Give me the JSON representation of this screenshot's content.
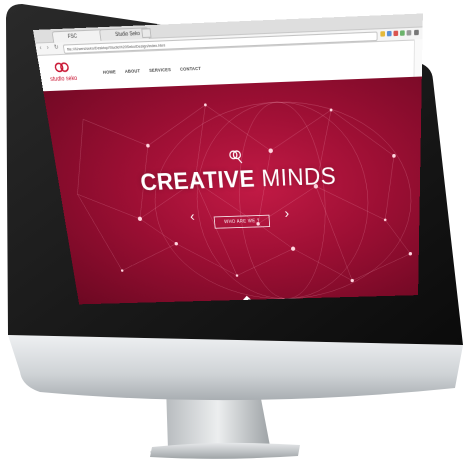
{
  "browser": {
    "tab1_title": "FSC Syndication",
    "tab2_title": "Studio Seko",
    "url": "file:///Users/seko/Desktop/Studio%20Seko/Design/index.html"
  },
  "site": {
    "logo_text": "studio seko",
    "menu": [
      "HOME",
      "ABOUT",
      "SERVICES",
      "CONTACT"
    ],
    "headline_line1": "CREATIVE",
    "headline_line2": "MINDS",
    "cta_label": "WHO ARE WE ?",
    "accent_color": "#9d0f34"
  },
  "icons": {
    "left_arrow": "chevron-left-icon",
    "right_arrow": "chevron-right-icon",
    "lens": "magnifier-icon"
  }
}
